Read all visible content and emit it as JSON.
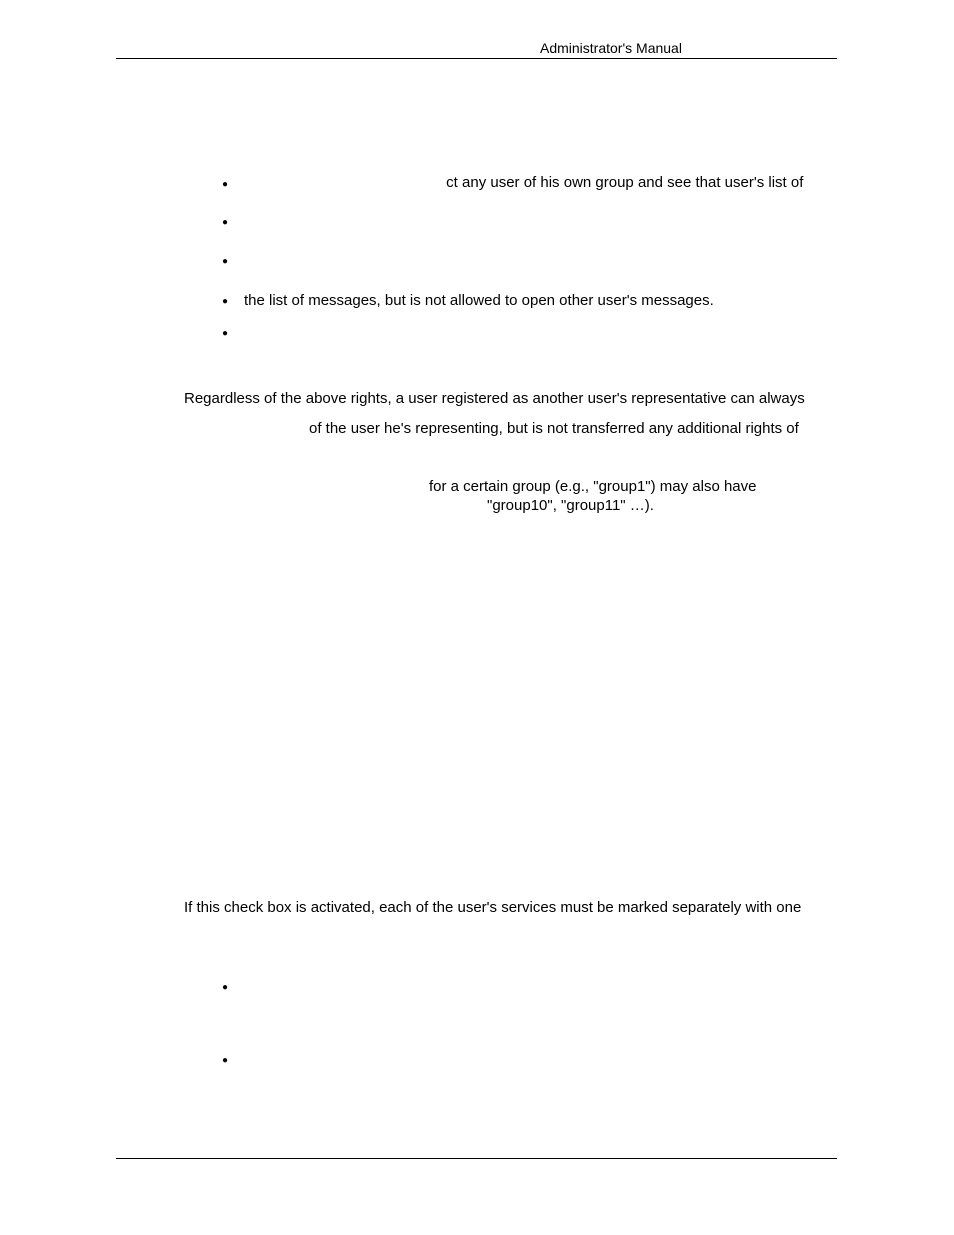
{
  "header": "Administrator's Manual",
  "b1_text1": "ct any user of his own group and see that user's list of",
  "b3_line": "the list of messages, but is not allowed to open other user's messages.",
  "para_regardless": "Regardless of the above rights, a user registered as another user's representative can always",
  "para_representing": "of the user he's representing, but is not transferred any additional rights of",
  "para_group1": "for a certain group (e.g., \"group1\") may also have",
  "para_group2": "\"group10\", \"group11\" …).",
  "para_checkbox": "If this check box is activated, each of the user's services must be marked separately with one"
}
